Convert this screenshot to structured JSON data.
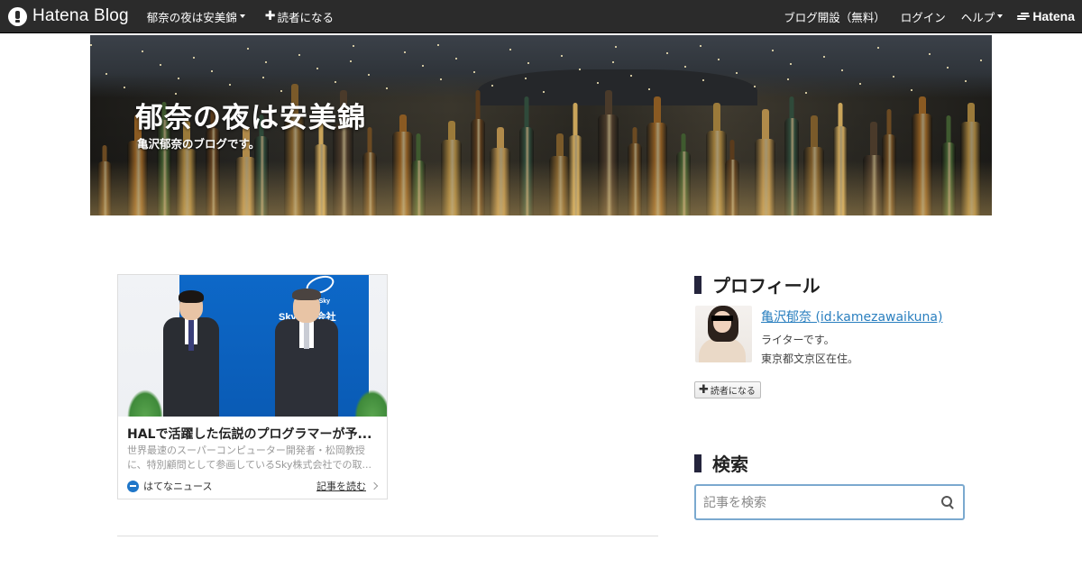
{
  "globalheader": {
    "brand": "Hatena Blog",
    "blog_menu": "郁奈の夜は安美錦",
    "subscribe": "読者になる",
    "signup": "ブログ開設（無料）",
    "login": "ログイン",
    "help": "ヘルプ",
    "hatena": "Hatena"
  },
  "blog": {
    "title": "郁奈の夜は安美錦",
    "description": "亀沢郁奈のブログです。"
  },
  "card": {
    "title": "HALで活躍した伝説のプログラマーが予...",
    "description": "世界最速のスーパーコンピューター開発者・松岡教授に、特別顧問として参画しているSky株式会社での取...",
    "source": "はてなニュース",
    "read_more": "記事を読む",
    "photo_text_1": "In the Sky",
    "photo_text_2": "Sky株式会社"
  },
  "sidebar": {
    "profile_title": "プロフィール",
    "profile_name": "亀沢郁奈 (id:kamezawaikuna)",
    "profile_line1": "ライターです。",
    "profile_line2": "東京都文京区在住。",
    "follow_button": "読者になる",
    "search_title": "検索",
    "search_placeholder": "記事を検索"
  },
  "colors": {
    "nav_bg": "#2b2b2b",
    "link": "#2a7fbf",
    "module_mark": "#24243c",
    "search_border": "#7ba9cf"
  }
}
